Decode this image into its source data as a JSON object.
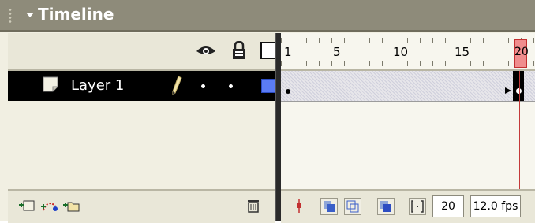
{
  "panel": {
    "title": "Timeline"
  },
  "ruler": {
    "frame_labels": [
      "1",
      "5",
      "10",
      "15",
      "20"
    ],
    "current_frame": "20"
  },
  "layers": [
    {
      "name": "Layer 1",
      "selected": true,
      "outline_color": "#5b7cf4"
    }
  ],
  "header_icons": [
    "eye-icon",
    "lock-icon",
    "outline-icon"
  ],
  "footer": {
    "left_icons": [
      "insert-layer-icon",
      "add-motion-guide-icon",
      "insert-layer-folder-icon",
      "delete-layer-icon"
    ],
    "current_frame": "20",
    "frame_rate": "12.0 fps"
  },
  "colors": {
    "title_bar": "#8e8b7a",
    "playhead": "#f08d8d",
    "selection": "#000000"
  }
}
